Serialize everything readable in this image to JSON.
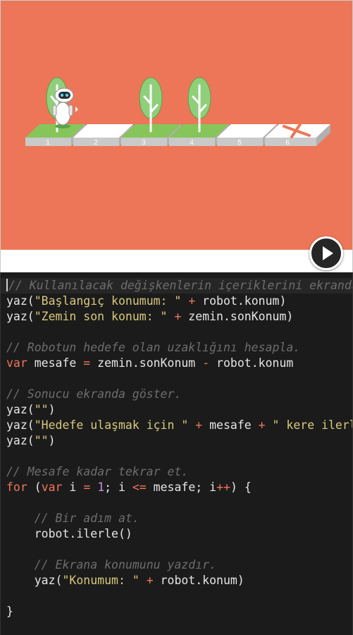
{
  "scene": {
    "tiles": [
      "1",
      "2",
      "3",
      "4",
      "5",
      "6"
    ],
    "colors": {
      "background": "#ec7657",
      "grass": "#86c55a",
      "tile_white": "#ffffff",
      "tile_side": "#c9c9c9",
      "tree_leaf": "#8fcf7a",
      "trunk": "#ffffff",
      "target_mark": "#ec7657"
    },
    "icons": [
      "robot-icon",
      "tree-icon",
      "target-x-icon"
    ]
  },
  "controls": {
    "play_icon": "play-icon"
  },
  "code": {
    "lines": [
      {
        "kind": "comment",
        "tokens": [
          {
            "t": "cm",
            "v": "// Kullanılacak değişkenlerin içeriklerini ekranda"
          }
        ],
        "current": true
      },
      {
        "kind": "code",
        "tokens": [
          {
            "t": "id",
            "v": "yaz("
          },
          {
            "t": "st",
            "v": "\"Başlangıç konumum: \""
          },
          {
            "t": "id",
            "v": " "
          },
          {
            "t": "op",
            "v": "+"
          },
          {
            "t": "id",
            "v": " robot.konum)"
          }
        ]
      },
      {
        "kind": "code",
        "tokens": [
          {
            "t": "id",
            "v": "yaz("
          },
          {
            "t": "st",
            "v": "\"Zemin son konum: \""
          },
          {
            "t": "id",
            "v": " "
          },
          {
            "t": "op",
            "v": "+"
          },
          {
            "t": "id",
            "v": " zemin.sonKonum)"
          }
        ]
      },
      {
        "kind": "blank",
        "tokens": []
      },
      {
        "kind": "comment",
        "tokens": [
          {
            "t": "cm",
            "v": "// Robotun hedefe olan uzaklığını hesapla."
          }
        ]
      },
      {
        "kind": "code",
        "tokens": [
          {
            "t": "kw",
            "v": "var"
          },
          {
            "t": "id",
            "v": " mesafe "
          },
          {
            "t": "op",
            "v": "="
          },
          {
            "t": "id",
            "v": " zemin.sonKonum "
          },
          {
            "t": "op",
            "v": "-"
          },
          {
            "t": "id",
            "v": " robot.konum"
          }
        ]
      },
      {
        "kind": "blank",
        "tokens": []
      },
      {
        "kind": "comment",
        "tokens": [
          {
            "t": "cm",
            "v": "// Sonucu ekranda göster."
          }
        ]
      },
      {
        "kind": "code",
        "tokens": [
          {
            "t": "id",
            "v": "yaz("
          },
          {
            "t": "st",
            "v": "\"\""
          },
          {
            "t": "id",
            "v": ")"
          }
        ]
      },
      {
        "kind": "code",
        "tokens": [
          {
            "t": "id",
            "v": "yaz("
          },
          {
            "t": "st",
            "v": "\"Hedefe ulaşmak için \""
          },
          {
            "t": "id",
            "v": " "
          },
          {
            "t": "op",
            "v": "+"
          },
          {
            "t": "id",
            "v": " mesafe "
          },
          {
            "t": "op",
            "v": "+"
          },
          {
            "t": "id",
            "v": " "
          },
          {
            "t": "st",
            "v": "\" kere ilerle"
          }
        ]
      },
      {
        "kind": "code",
        "tokens": [
          {
            "t": "id",
            "v": "yaz("
          },
          {
            "t": "st",
            "v": "\"\""
          },
          {
            "t": "id",
            "v": ")"
          }
        ]
      },
      {
        "kind": "blank",
        "tokens": []
      },
      {
        "kind": "comment",
        "tokens": [
          {
            "t": "cm",
            "v": "// Mesafe kadar tekrar et."
          }
        ]
      },
      {
        "kind": "code",
        "tokens": [
          {
            "t": "kw",
            "v": "for"
          },
          {
            "t": "id",
            "v": " ("
          },
          {
            "t": "kw",
            "v": "var"
          },
          {
            "t": "id",
            "v": " i "
          },
          {
            "t": "op",
            "v": "="
          },
          {
            "t": "id",
            "v": " "
          },
          {
            "t": "nm",
            "v": "1"
          },
          {
            "t": "id",
            "v": "; i "
          },
          {
            "t": "op",
            "v": "<="
          },
          {
            "t": "id",
            "v": " mesafe; i"
          },
          {
            "t": "op",
            "v": "++"
          },
          {
            "t": "id",
            "v": ") {"
          }
        ]
      },
      {
        "kind": "blank",
        "tokens": []
      },
      {
        "kind": "comment",
        "tokens": [
          {
            "t": "id",
            "v": "    "
          },
          {
            "t": "cm",
            "v": "// Bir adım at."
          }
        ]
      },
      {
        "kind": "code",
        "tokens": [
          {
            "t": "id",
            "v": "    robot.ilerle()"
          }
        ]
      },
      {
        "kind": "blank",
        "tokens": []
      },
      {
        "kind": "comment",
        "tokens": [
          {
            "t": "id",
            "v": "    "
          },
          {
            "t": "cm",
            "v": "// Ekrana konumunu yazdır."
          }
        ]
      },
      {
        "kind": "code",
        "tokens": [
          {
            "t": "id",
            "v": "    yaz("
          },
          {
            "t": "st",
            "v": "\"Konumum: \""
          },
          {
            "t": "id",
            "v": " "
          },
          {
            "t": "op",
            "v": "+"
          },
          {
            "t": "id",
            "v": " robot.konum)"
          }
        ]
      },
      {
        "kind": "blank",
        "tokens": []
      },
      {
        "kind": "code",
        "tokens": [
          {
            "t": "id",
            "v": "}"
          }
        ]
      }
    ]
  }
}
